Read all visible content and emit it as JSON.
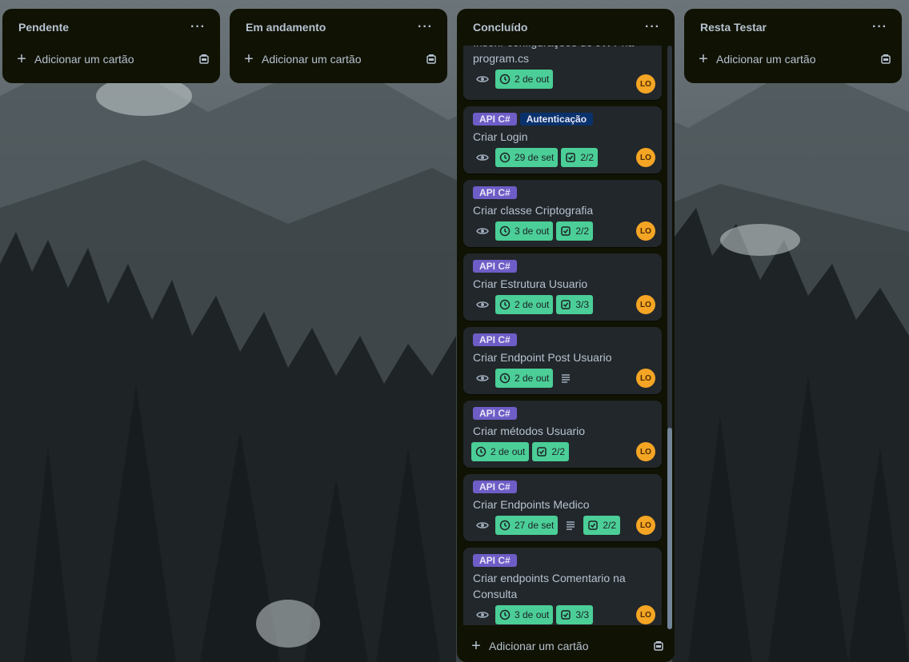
{
  "lists": [
    {
      "title": "Pendente",
      "add_label": "Adicionar um cartão"
    },
    {
      "title": "Em andamento",
      "add_label": "Adicionar um cartão"
    },
    {
      "title": "Concluído",
      "add_label": "Adicionar um cartão"
    },
    {
      "title": "Resta Testar",
      "add_label": "Adicionar um cartão"
    }
  ],
  "menu_glyph": "···",
  "label_colors": {
    "api": "#6e5dc6",
    "auth": "#09326c"
  },
  "avatar_color": "#f5a524",
  "date_badge_color": "#4bce97",
  "cards": [
    {
      "labels": [],
      "title": "Inserir configurações do JWT na program.cs",
      "date": "2 de out",
      "checklist": null,
      "avatar": "LO"
    },
    {
      "labels": [
        "API C#",
        "Autenticação"
      ],
      "title": "Criar Login",
      "date": "29 de set",
      "checklist": "2/2",
      "avatar": "LO"
    },
    {
      "labels": [
        "API C#"
      ],
      "title": "Criar classe Criptografia",
      "date": "3 de out",
      "checklist": "2/2",
      "avatar": "LO"
    },
    {
      "labels": [
        "API C#"
      ],
      "title": "Criar Estrutura Usuario",
      "date": "2 de out",
      "checklist": "3/3",
      "avatar": "LO"
    },
    {
      "labels": [
        "API C#"
      ],
      "title": "Criar Endpoint Post Usuario",
      "date": "2 de out",
      "checklist": null,
      "avatar": "LO"
    },
    {
      "labels": [
        "API C#"
      ],
      "title": "Criar métodos Usuario",
      "date": "2 de out",
      "checklist": "2/2",
      "avatar": "LO"
    },
    {
      "labels": [
        "API C#"
      ],
      "title": "Criar Endpoints Medico",
      "date": "27 de set",
      "checklist": "2/2",
      "avatar": "LO"
    },
    {
      "labels": [
        "API C#"
      ],
      "title": "Criar endpoints Comentario na Consulta",
      "date": "3 de out",
      "checklist": "3/3",
      "avatar": "LO"
    }
  ]
}
